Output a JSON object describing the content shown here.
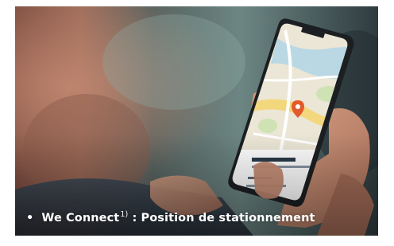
{
  "caption": {
    "bullet": "•",
    "title": "We Connect",
    "footnote": "1)",
    "rest": " : Position de stationnement"
  },
  "photo": {
    "subject": "hand-holding-smartphone-with-map",
    "colors": {
      "background_dark": "#3c4a4c",
      "background_teal": "#6f8b86",
      "skin": "#c48a72",
      "phone_body": "#1c1f22",
      "map_base": "#ece6d6",
      "map_water": "#b9d8e4",
      "map_road": "#f3d77c",
      "map_park": "#cfe2b4",
      "pin": "#e25a2c"
    }
  }
}
